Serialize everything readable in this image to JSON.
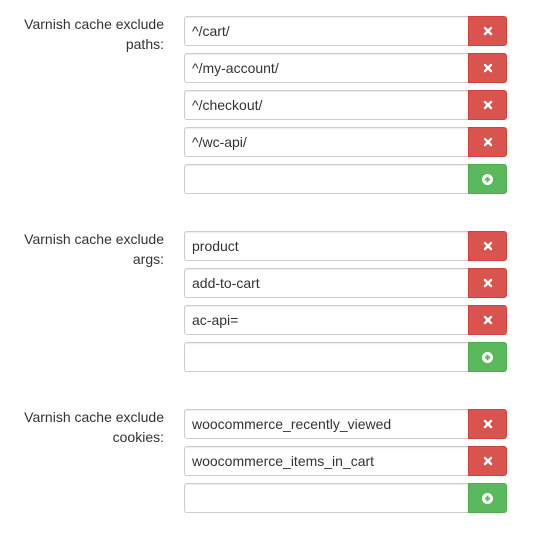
{
  "sections": [
    {
      "label_line1": "Varnish cache exclude",
      "label_line2": "paths:",
      "rows": [
        {
          "value": "^/cart/"
        },
        {
          "value": "^/my-account/"
        },
        {
          "value": "^/checkout/"
        },
        {
          "value": "^/wc-api/"
        }
      ],
      "new_value": ""
    },
    {
      "label_line1": "Varnish cache exclude",
      "label_line2": "args:",
      "rows": [
        {
          "value": "product"
        },
        {
          "value": "add-to-cart"
        },
        {
          "value": "ac-api="
        }
      ],
      "new_value": ""
    },
    {
      "label_line1": "Varnish cache exclude",
      "label_line2": "cookies:",
      "rows": [
        {
          "value": "woocommerce_recently_viewed"
        },
        {
          "value": "woocommerce_items_in_cart"
        }
      ],
      "new_value": ""
    }
  ],
  "icons": {
    "remove": "close-icon",
    "add": "plus-circle-icon"
  },
  "colors": {
    "remove_button": "#d9534f",
    "add_button": "#5cb85c"
  }
}
